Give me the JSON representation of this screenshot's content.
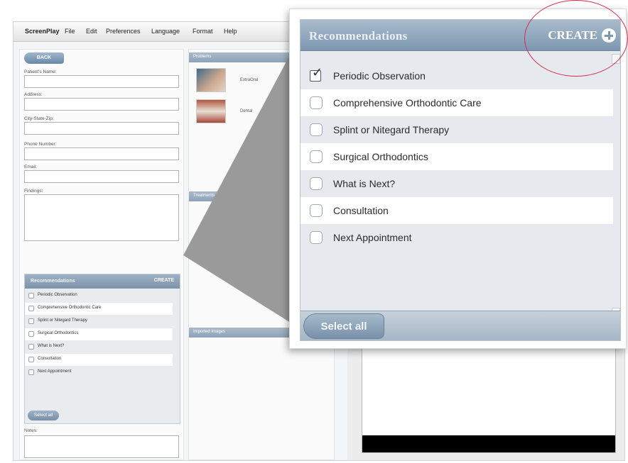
{
  "menu": {
    "app_name": "ScreenPlay",
    "items": [
      "File",
      "Edit",
      "Preferences",
      "Language",
      "Format",
      "Help"
    ]
  },
  "form": {
    "back_label": "BACK",
    "fields": [
      {
        "label": "Patient's Name:"
      },
      {
        "label": "Address:"
      },
      {
        "label": "City-State-Zip:"
      },
      {
        "label": "Phone Number:"
      },
      {
        "label": "Email:"
      }
    ],
    "findings_label": "Findings:",
    "notes_label": "Notes:"
  },
  "middle": {
    "problems_title": "Problems",
    "treatments_title": "Treatments",
    "imported_title": "Imported Images",
    "thumbs": [
      {
        "label": "ExtraOral"
      },
      {
        "label": "Dental"
      }
    ]
  },
  "recommendations": {
    "title": "Recommendations",
    "create_label": "CREATE",
    "select_all_label": "Select all",
    "items": [
      {
        "label": "Periodic Observation",
        "checked": true
      },
      {
        "label": "Comprehensive Orthodontic Care",
        "checked": false
      },
      {
        "label": "Splint or Nitegard Therapy",
        "checked": false
      },
      {
        "label": "Surgical Orthodontics",
        "checked": false
      },
      {
        "label": "What is Next?",
        "checked": false
      },
      {
        "label": "Consultation",
        "checked": false
      },
      {
        "label": "Next Appointment",
        "checked": false
      }
    ]
  },
  "colors": {
    "header_blue": "#7e97b0",
    "highlight_ring": "#d42a4c",
    "wedge_gray": "#9a9a9a"
  }
}
